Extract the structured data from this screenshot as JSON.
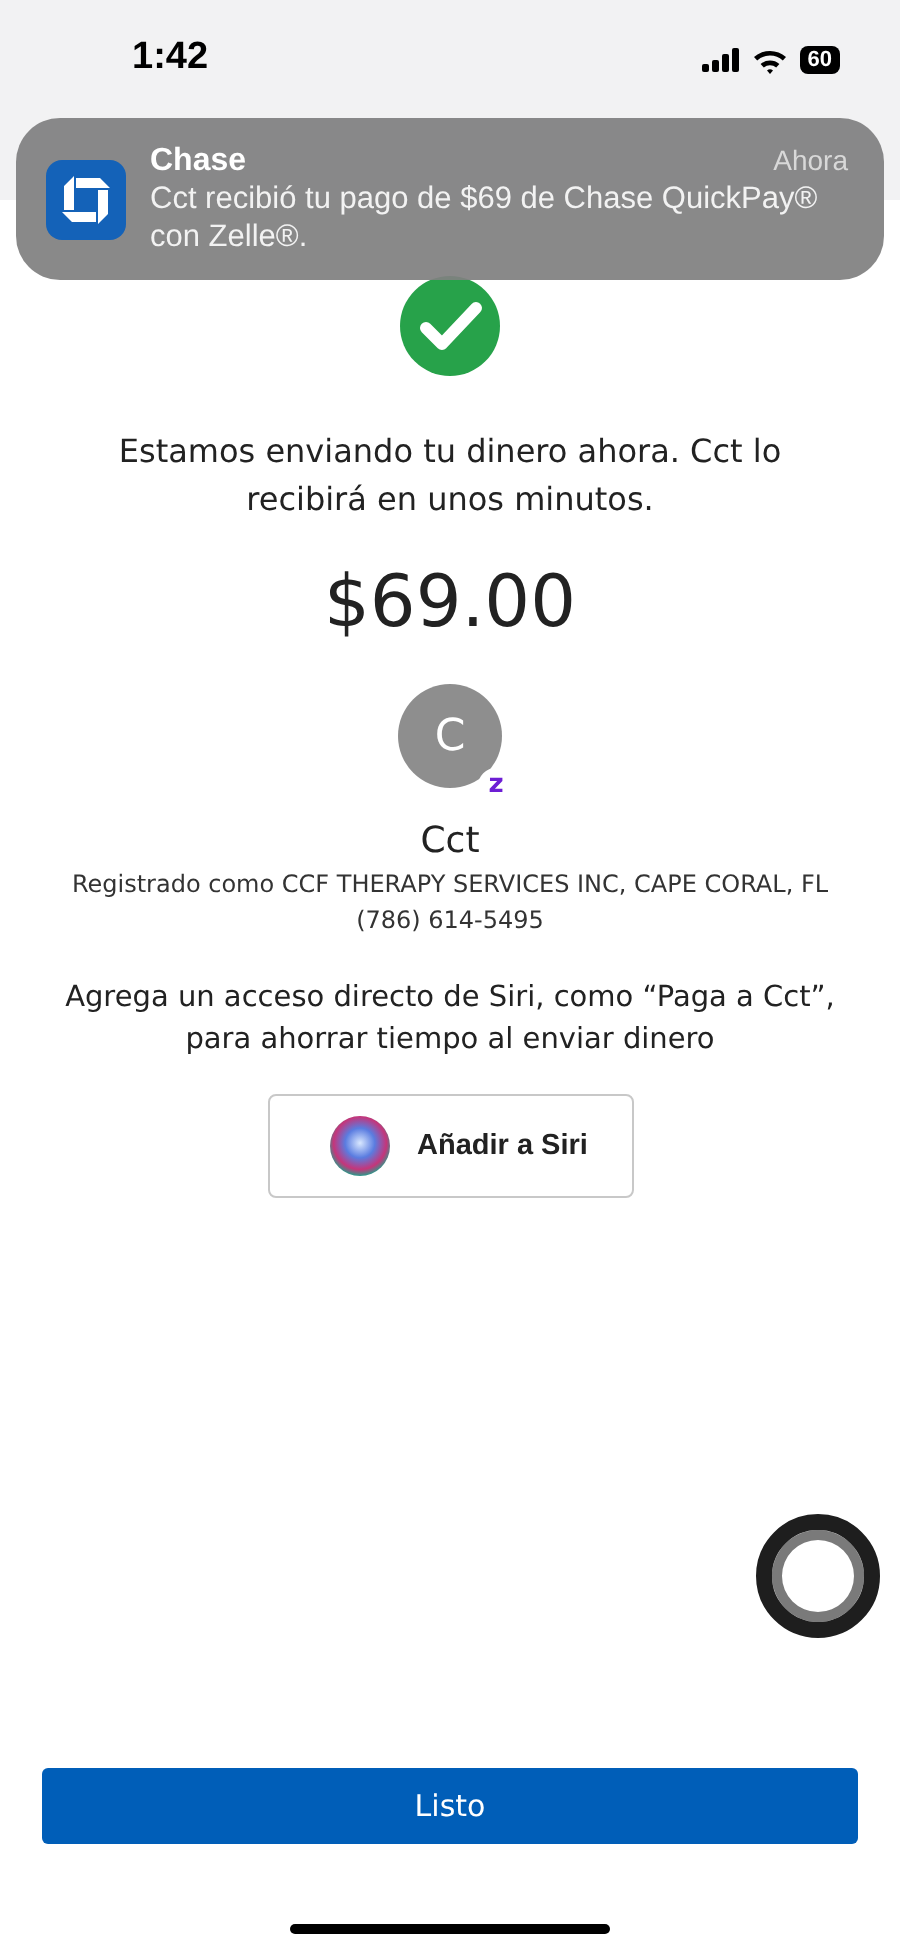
{
  "status_bar": {
    "time": "1:42",
    "battery": "60"
  },
  "notification": {
    "app": "Chase",
    "time": "Ahora",
    "message": "Cct recibió tu pago de $69 de Chase QuickPay® con Zelle®."
  },
  "confirmation": {
    "message": "Estamos enviando tu dinero ahora. Cct lo recibirá en unos minutos.",
    "amount": "$69.00"
  },
  "recipient": {
    "initial": "C",
    "badge": "z",
    "name": "Cct",
    "registered": "Registrado como CCF THERAPY SERVICES INC, CAPE CORAL, FL",
    "phone": "(786) 614-5495"
  },
  "siri": {
    "hint": "Agrega un acceso directo de Siri, como “Paga a Cct”, para ahorrar tiempo al enviar dinero",
    "button": "Añadir a Siri"
  },
  "done_button": "Listo"
}
